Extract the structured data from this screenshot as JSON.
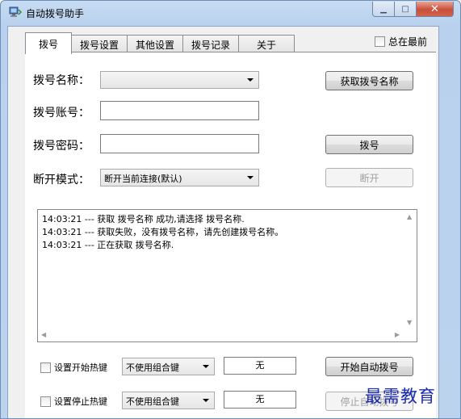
{
  "window": {
    "title": "自动拨号助手",
    "minimize_glyph": "▁",
    "maximize_glyph": "□",
    "close_glyph": "✕"
  },
  "tabs": [
    "拨号",
    "拨号设置",
    "其他设置",
    "拨号记录",
    "关于"
  ],
  "active_tab": "拨号",
  "always_on_top": {
    "label": "总在最前",
    "checked": false
  },
  "form": {
    "dial_name_label": "拨号名称：",
    "dial_name_value": "",
    "account_label": "拨号账号：",
    "account_value": "",
    "password_label": "拨号密码：",
    "password_value": "",
    "disconnect_mode_label": "断开模式：",
    "disconnect_mode_value": "断开当前连接(默认)"
  },
  "buttons": {
    "get_dial_name": "获取拨号名称",
    "dial": "拨号",
    "disconnect": "断开",
    "start_auto_dial": "开始自动拨号",
    "stop_auto_dial": "停止自动拨号"
  },
  "log": [
    "14:03:21 --- 获取 拨号名称 成功,请选择 拨号名称.",
    "14:03:21 --- 获取失败，没有拨号名称，请先创建拨号名称。",
    "14:03:21 --- 正在获取 拨号名称."
  ],
  "hotkeys": {
    "start": {
      "label": "设置开始热键",
      "checked": false,
      "modifier": "不使用组合键",
      "key": "无"
    },
    "stop": {
      "label": "设置停止热键",
      "checked": false,
      "modifier": "不使用组合键",
      "key": "无"
    }
  },
  "watermark": "最需教育",
  "colors": {
    "titlebar": "#bcd3ee",
    "close_button": "#c9503a",
    "watermark": "#1c2bb0"
  }
}
